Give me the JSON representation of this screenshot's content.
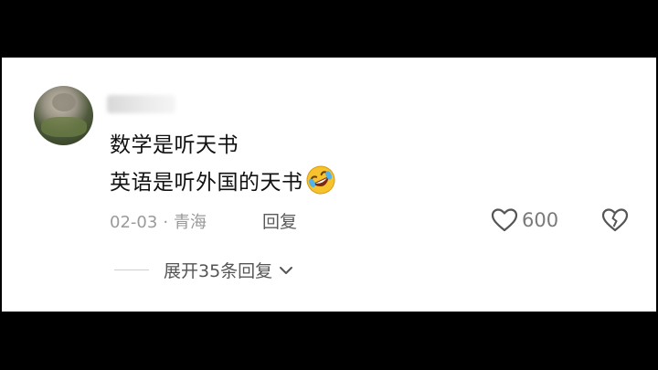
{
  "comment": {
    "line1": "数学是听天书",
    "line2": "英语是听外国的天书",
    "emoji": "rolling-on-floor-laughing-emoji"
  },
  "meta": {
    "date": "02-03",
    "separator": "·",
    "location": "青海",
    "reply_label": "回复"
  },
  "actions": {
    "like_icon": "heart-outline-icon",
    "like_count": "600",
    "dislike_icon": "broken-heart-icon"
  },
  "replies": {
    "expand_label": "展开35条回复",
    "chevron_icon": "chevron-down-icon"
  },
  "colors": {
    "background": "#000000",
    "card": "#ffffff",
    "text": "#111111",
    "meta": "#9a9a9a",
    "emoji": "#f6c22e"
  }
}
